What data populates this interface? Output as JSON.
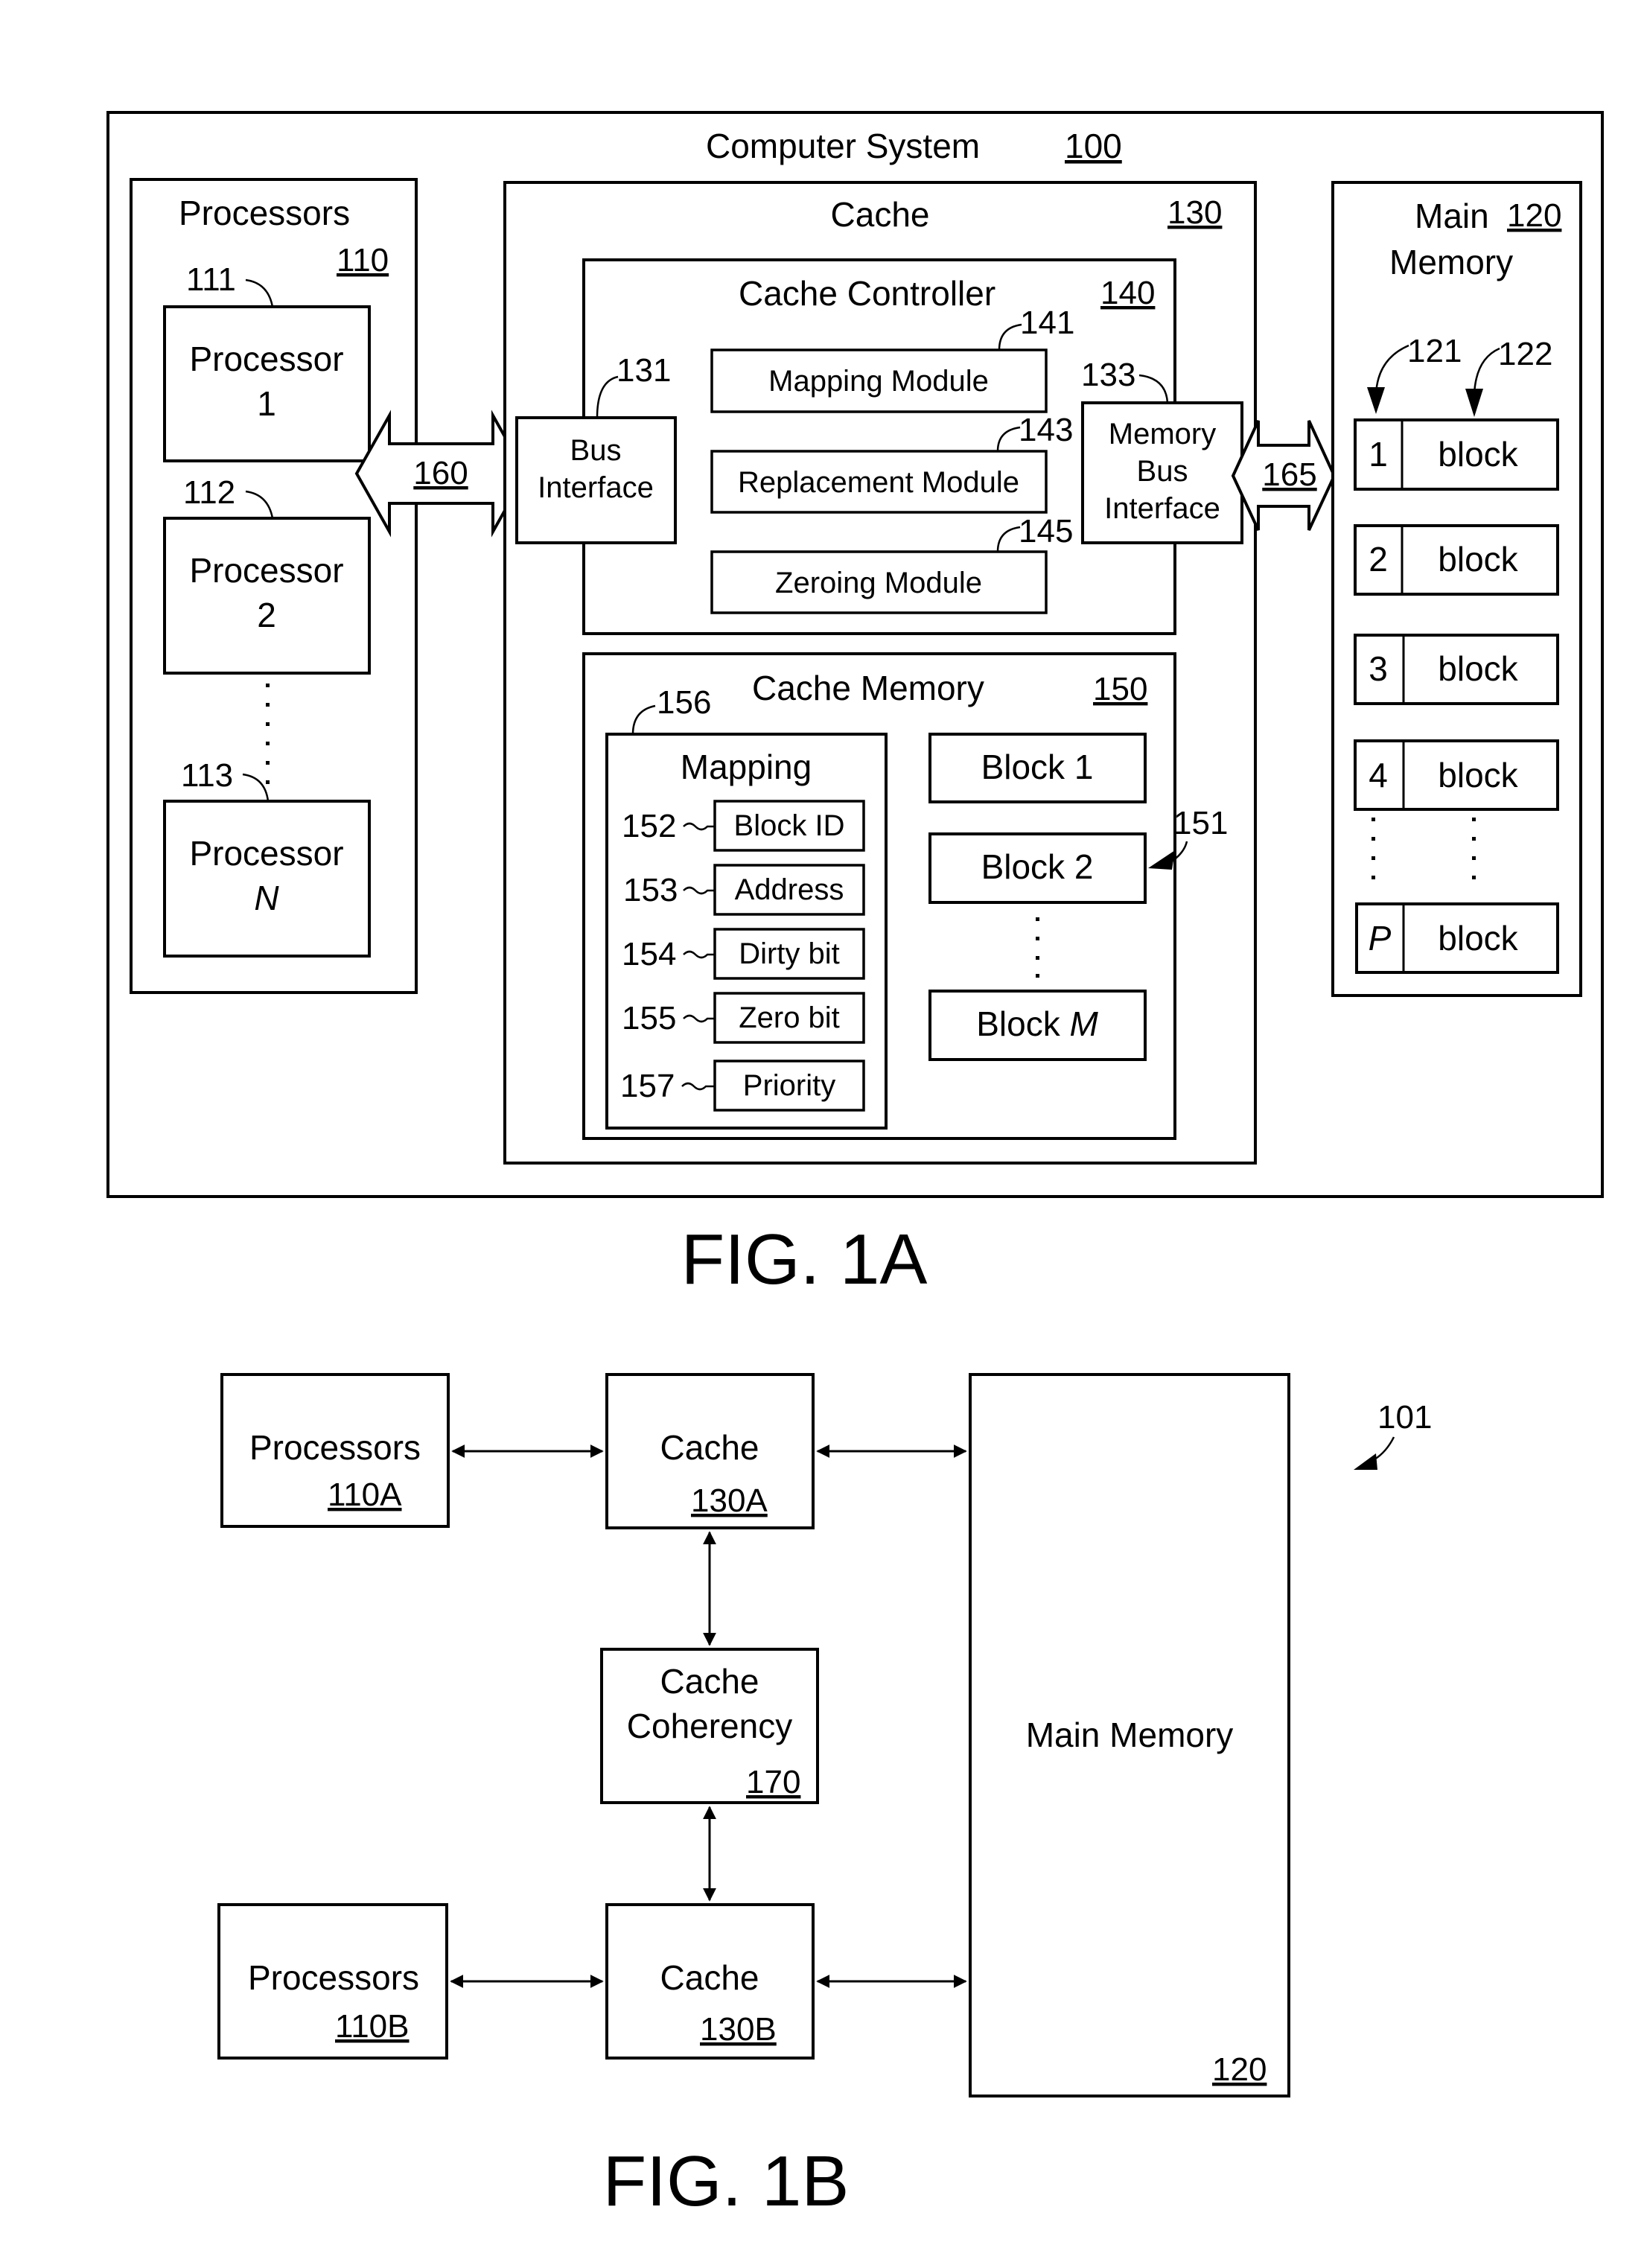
{
  "fig1a": {
    "caption": "FIG. 1A",
    "system": {
      "title": "Computer System",
      "ref": "100"
    },
    "processors": {
      "title": "Processors",
      "ref": "110",
      "items": [
        {
          "ref": "111",
          "line1": "Processor",
          "line2": "1"
        },
        {
          "ref": "112",
          "line1": "Processor",
          "line2": "2"
        },
        {
          "ref": "113",
          "line1": "Processor",
          "line2": "N"
        }
      ]
    },
    "bus_160": {
      "ref": "160"
    },
    "bus_165": {
      "ref": "165"
    },
    "cache": {
      "title": "Cache",
      "ref": "130",
      "bus_interface": {
        "ref": "131",
        "line1": "Bus",
        "line2": "Interface"
      },
      "memory_bus_interface": {
        "ref": "133",
        "line1": "Memory",
        "line2": "Bus",
        "line3": "Interface"
      },
      "controller": {
        "title": "Cache Controller",
        "ref": "140",
        "modules": [
          {
            "ref": "141",
            "label": "Mapping Module"
          },
          {
            "ref": "143",
            "label": "Replacement Module"
          },
          {
            "ref": "145",
            "label": "Zeroing Module"
          }
        ]
      },
      "memory": {
        "title": "Cache Memory",
        "ref": "150",
        "blocks_ref": "151",
        "mapping": {
          "ref": "156",
          "title": "Mapping",
          "fields": [
            {
              "ref": "152",
              "label": "Block ID"
            },
            {
              "ref": "153",
              "label": "Address"
            },
            {
              "ref": "154",
              "label": "Dirty bit"
            },
            {
              "ref": "155",
              "label": "Zero bit"
            },
            {
              "ref": "157",
              "label": "Priority"
            }
          ]
        },
        "blocks": [
          {
            "prefix": "Block",
            "index": "1"
          },
          {
            "prefix": "Block",
            "index": "2"
          },
          {
            "prefix": "Block",
            "index": "M"
          }
        ]
      }
    },
    "main_memory": {
      "line1": "Main",
      "line2": "Memory",
      "ref": "120",
      "index_ref": "121",
      "block_ref": "122",
      "rows": [
        {
          "index": "1",
          "label": "block"
        },
        {
          "index": "2",
          "label": "block"
        },
        {
          "index": "3",
          "label": "block"
        },
        {
          "index": "4",
          "label": "block"
        },
        {
          "index": "P",
          "label": "block"
        }
      ]
    }
  },
  "fig1b": {
    "caption": "FIG. 1B",
    "system_ref": "101",
    "processors_a": {
      "label": "Processors",
      "ref": "110A"
    },
    "processors_b": {
      "label": "Processors",
      "ref": "110B"
    },
    "cache_a": {
      "label": "Cache",
      "ref": "130A"
    },
    "cache_b": {
      "label": "Cache",
      "ref": "130B"
    },
    "coherency": {
      "line1": "Cache",
      "line2": "Coherency",
      "ref": "170"
    },
    "main_memory": {
      "label": "Main Memory",
      "ref": "120"
    }
  }
}
